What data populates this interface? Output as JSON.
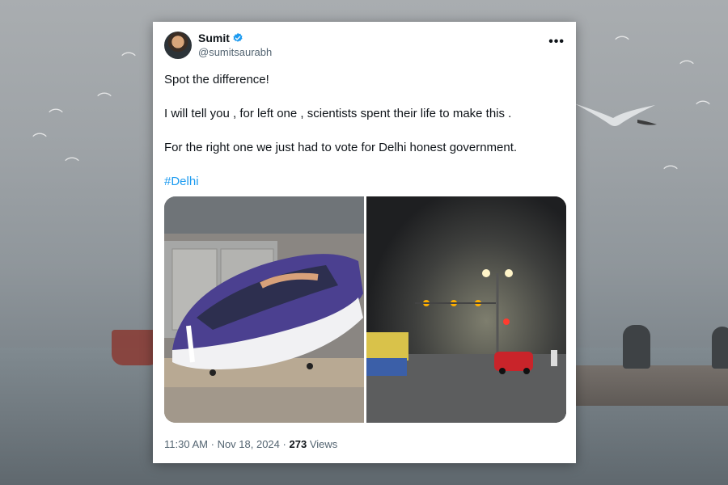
{
  "tweet": {
    "display_name": "Sumit",
    "handle": "@sumitsaurabh",
    "more_icon": "more-icon",
    "verified_icon": "verified-badge-icon",
    "text_line_1": "Spot the difference!",
    "text_line_2": "I will tell you , for left one , scientists spent their life to make this .",
    "text_line_3": "For the right one we just had to vote for Delhi honest government.",
    "hashtag": "#Delhi",
    "time": "11:30 AM",
    "date": "Nov 18, 2024",
    "separator": "·",
    "views_count": "273",
    "views_label": "Views"
  },
  "colors": {
    "link": "#1d9bf0",
    "verified": "#1d9bf0",
    "text": "#0f1419",
    "muted": "#536471"
  }
}
